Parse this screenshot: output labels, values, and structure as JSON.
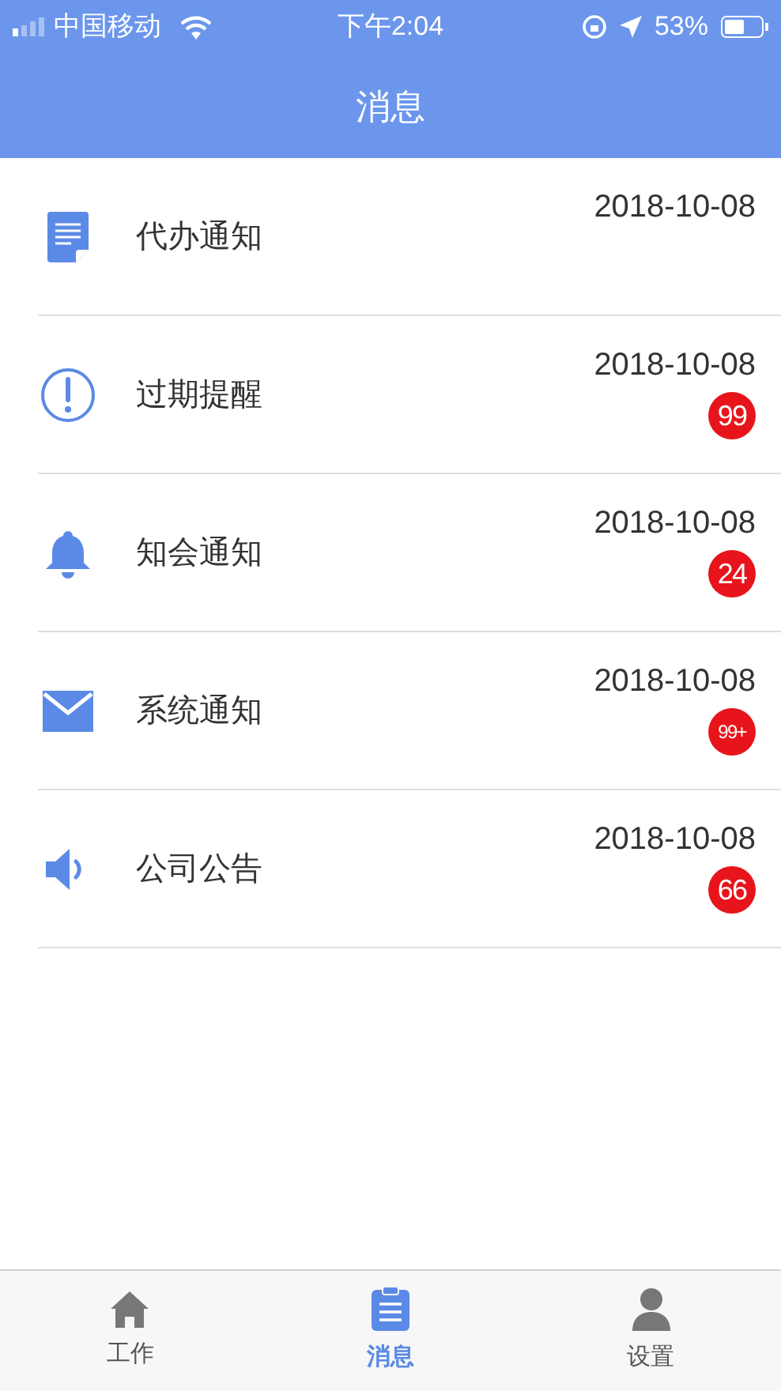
{
  "status_bar": {
    "carrier": "中国移动",
    "time": "下午2:04",
    "battery": "53%"
  },
  "header": {
    "title": "消息"
  },
  "messages": [
    {
      "kind": "todo",
      "title": "代办通知",
      "date": "2018-10-08"
    },
    {
      "kind": "alert",
      "title": "过期提醒",
      "date": "2018-10-08",
      "badge": "99"
    },
    {
      "kind": "bell",
      "title": "知会通知",
      "date": "2018-10-08",
      "badge": "24"
    },
    {
      "kind": "mail",
      "title": "系统通知",
      "date": "2018-10-08",
      "badge": "99+"
    },
    {
      "kind": "speaker",
      "title": "公司公告",
      "date": "2018-10-08",
      "badge": "66"
    }
  ],
  "tabs": [
    {
      "kind": "home",
      "label": "工作",
      "selected": false
    },
    {
      "kind": "clipboard",
      "label": "消息",
      "selected": true
    },
    {
      "kind": "person",
      "label": "设置",
      "selected": false
    }
  ]
}
